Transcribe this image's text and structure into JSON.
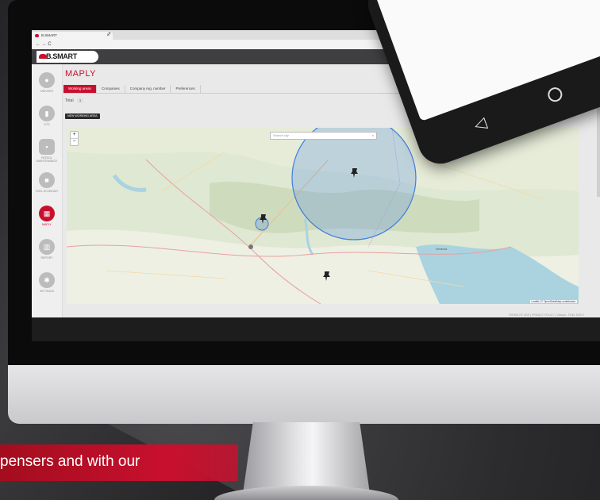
{
  "browser": {
    "tab_title": "B.SMART",
    "new_tab": "+",
    "nav": "← → C"
  },
  "app": {
    "logo": "B.SMART",
    "page_title": "MAPLY"
  },
  "sidebar": {
    "items": [
      {
        "label": "DRIVERS",
        "icon": "person-icon"
      },
      {
        "label": "DTS",
        "icon": "fuel-pump-icon"
      },
      {
        "label": "Patrol MAINTENANCE",
        "icon": "wrench-icon"
      },
      {
        "label": "FUEL ECONOMY",
        "icon": "truck-icon"
      },
      {
        "label": "MAPLY",
        "icon": "map-icon"
      },
      {
        "label": "REPORT",
        "icon": "chart-icon"
      },
      {
        "label": "SETTINGS",
        "icon": "gear-icon"
      }
    ]
  },
  "tabs": [
    "Working areas",
    "Companies",
    "Company reg. number",
    "Preferences"
  ],
  "total": {
    "label": "Total",
    "count": "3"
  },
  "new_area_button": "NEW WORKING AREA",
  "map": {
    "search_placeholder": "Search city",
    "zoom_in": "+",
    "zoom_out": "−",
    "attribution": "Leaflet | © OpenStreetMap contributors",
    "places": [
      "Venezia"
    ]
  },
  "footer": "TERMS OF USE | PRIVACY POLICY | Vitesse - FUEL SPA ©",
  "banner": "pensers and with our",
  "colors": {
    "accent": "#c8102e",
    "header": "#3f3f41"
  }
}
